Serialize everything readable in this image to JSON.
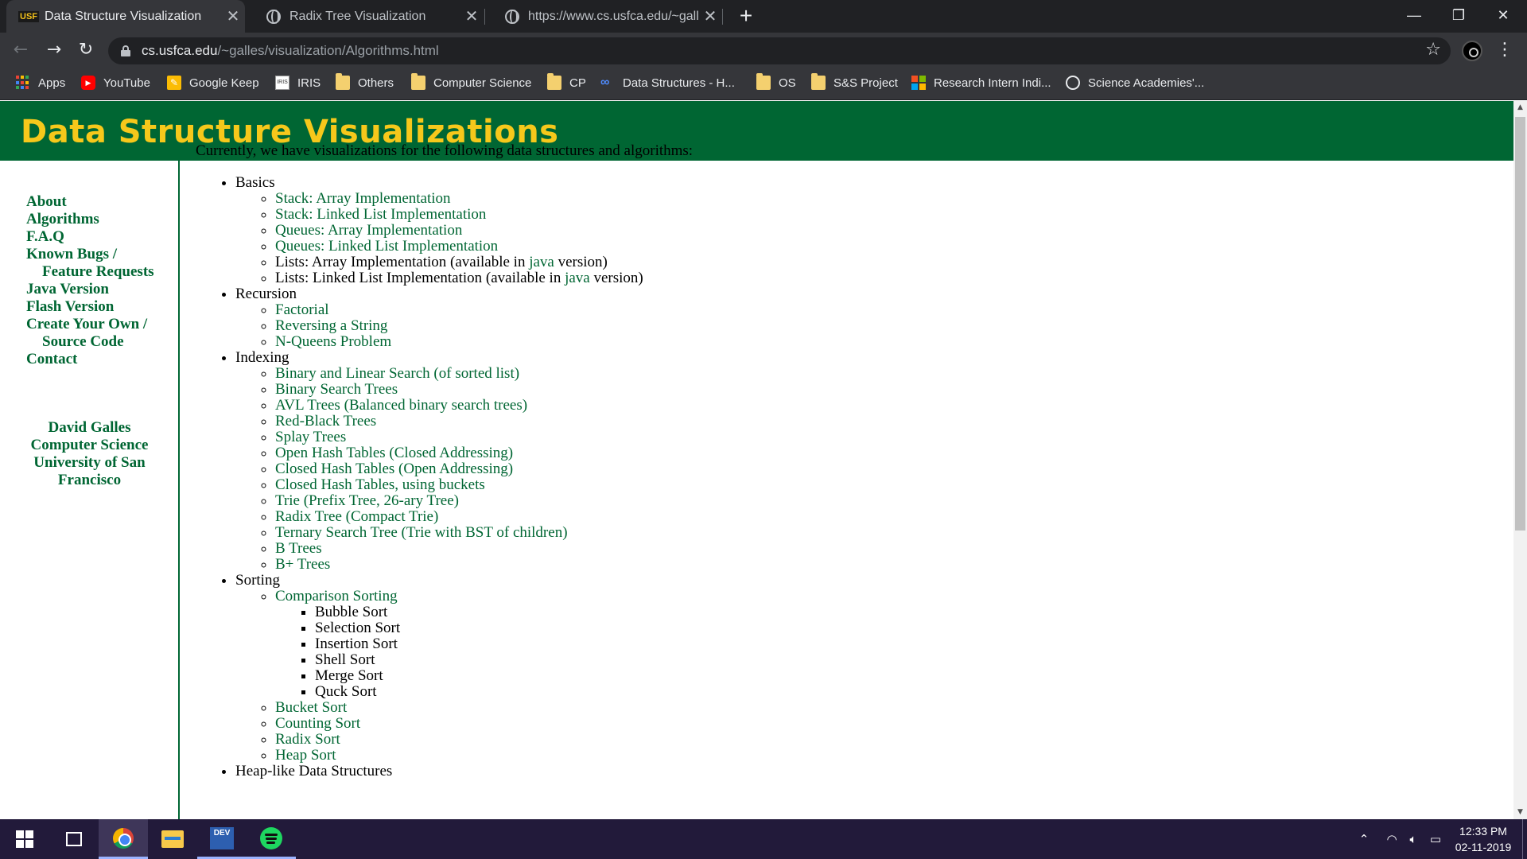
{
  "browser": {
    "tabs": [
      {
        "title": "Data Structure Visualization",
        "favicon": "USF",
        "active": true
      },
      {
        "title": "Radix Tree Visualization",
        "favicon": "globe-icon",
        "active": false
      },
      {
        "title": "https://www.cs.usfca.edu/~galles",
        "favicon": "globe-icon",
        "active": false
      }
    ],
    "url_host": "cs.usfca.edu",
    "url_path": "/~galles/visualization/Algorithms.html",
    "bookmarks": [
      "Apps",
      "YouTube",
      "Google Keep",
      "IRIS",
      "Others",
      "Computer Science",
      "CP",
      "Data Structures - H...",
      "OS",
      "S&S Project",
      "Research Intern Indi...",
      "Science Academies'..."
    ],
    "iris_icon_text": "IRIS",
    "dev_icon_text": "DEV"
  },
  "page": {
    "banner_title": "Data Structure Visualizations",
    "sidebar": {
      "nav": [
        "About",
        "Algorithms",
        "F.A.Q",
        "Known Bugs /",
        "Feature Requests",
        "Java Version",
        "Flash Version",
        "Create Your Own /",
        "Source Code",
        "Contact"
      ],
      "author": [
        "David Galles",
        "Computer Science",
        "University of San Francisco"
      ]
    },
    "intro": "Currently, we have visualizations for the following data structures and algorithms:",
    "sections": {
      "basics": {
        "title": "Basics",
        "items": [
          "Stack: Array Implementation",
          "Stack: Linked List Implementation",
          "Queues: Array Implementation",
          "Queues: Linked List Implementation"
        ],
        "list_array_pre": "Lists: Array Implementation (available in ",
        "list_linked_pre": "Lists: Linked List Implementation (available in ",
        "java": "java",
        "version_post": " version)"
      },
      "recursion": {
        "title": "Recursion",
        "items": [
          "Factorial",
          "Reversing a String",
          "N-Queens Problem"
        ]
      },
      "indexing": {
        "title": "Indexing",
        "items": [
          "Binary and Linear Search (of sorted list)",
          "Binary Search Trees",
          "AVL Trees (Balanced binary search trees)",
          "Red-Black Trees",
          "Splay Trees",
          "Open Hash Tables (Closed Addressing)",
          "Closed Hash Tables (Open Addressing)",
          "Closed Hash Tables, using buckets",
          "Trie (Prefix Tree, 26-ary Tree)",
          "Radix Tree (Compact Trie)",
          "Ternary Search Tree (Trie with BST of children)",
          "B Trees",
          "B+ Trees"
        ]
      },
      "sorting": {
        "title": "Sorting",
        "comparison": "Comparison Sorting",
        "comparison_items": [
          "Bubble Sort",
          "Selection Sort",
          "Insertion Sort",
          "Shell Sort",
          "Merge Sort",
          "Quck Sort"
        ],
        "items": [
          "Bucket Sort",
          "Counting Sort",
          "Radix Sort",
          "Heap Sort"
        ]
      },
      "heap": {
        "title": "Heap-like Data Structures"
      }
    }
  },
  "taskbar": {
    "time": "12:33 PM",
    "date": "02-11-2019"
  },
  "colors": {
    "brand_green": "#006633",
    "banner_gold": "#f6c81b",
    "chrome_dark": "#202124",
    "chrome_toolbar": "#35363a",
    "taskbar": "#221a3a"
  }
}
